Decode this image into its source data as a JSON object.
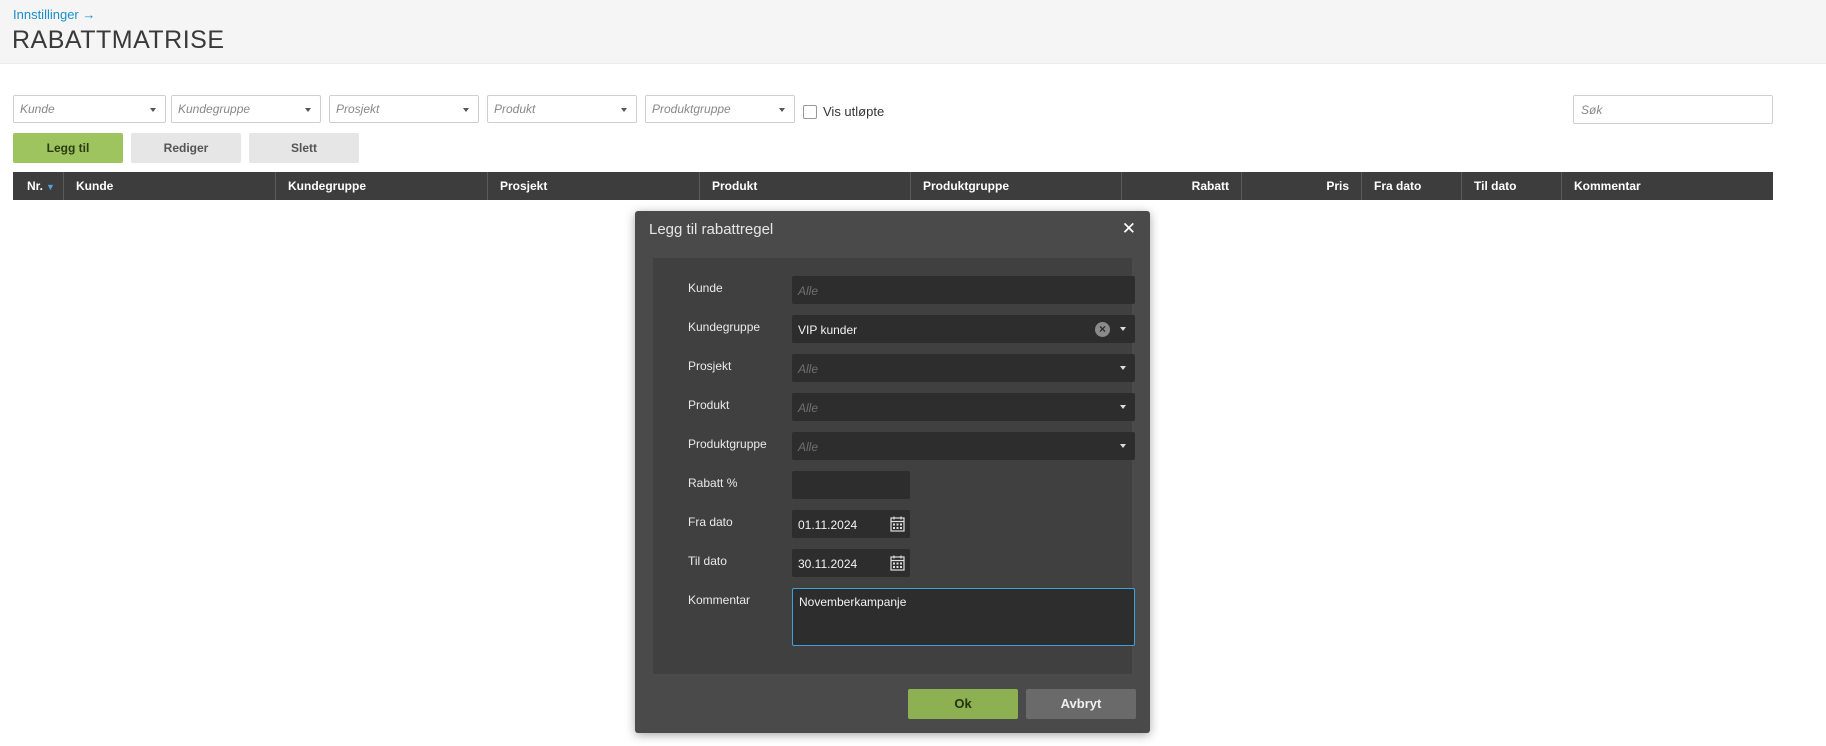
{
  "header": {
    "breadcrumb": "Innstillinger →",
    "title": "RABATTMATRISE"
  },
  "filters": {
    "customer": "Kunde",
    "customer_group": "Kundegruppe",
    "project": "Prosjekt",
    "product": "Produkt",
    "product_group": "Produktgruppe",
    "show_expired": "Vis utløpte",
    "search_placeholder": "Søk"
  },
  "toolbar": {
    "add": "Legg til",
    "edit": "Rediger",
    "delete": "Slett"
  },
  "table": {
    "columns": [
      "Nr.",
      "Kunde",
      "Kundegruppe",
      "Prosjekt",
      "Produkt",
      "Produktgruppe",
      "Rabatt",
      "Pris",
      "Fra dato",
      "Til dato",
      "Kommentar"
    ]
  },
  "dialog": {
    "title": "Legg til rabattregel",
    "labels": {
      "customer": "Kunde",
      "customer_group": "Kundegruppe",
      "project": "Prosjekt",
      "product": "Produkt",
      "product_group": "Produktgruppe",
      "discount": "Rabatt %",
      "from_date": "Fra dato",
      "to_date": "Til dato",
      "comment": "Kommentar"
    },
    "values": {
      "customer_placeholder": "Alle",
      "customer_group": "VIP kunder",
      "project_placeholder": "Alle",
      "product_placeholder": "Alle",
      "product_group_placeholder": "Alle",
      "discount": "",
      "from_date": "01.11.2024",
      "to_date": "30.11.2024",
      "comment": "Novemberkampanje"
    },
    "ok": "Ok",
    "cancel": "Avbryt"
  },
  "colors": {
    "accent_green": "#9dc45f",
    "header_dark": "#3d3d3d",
    "focus_blue": "#3fa1d6",
    "link_blue": "#1a8fc9"
  }
}
